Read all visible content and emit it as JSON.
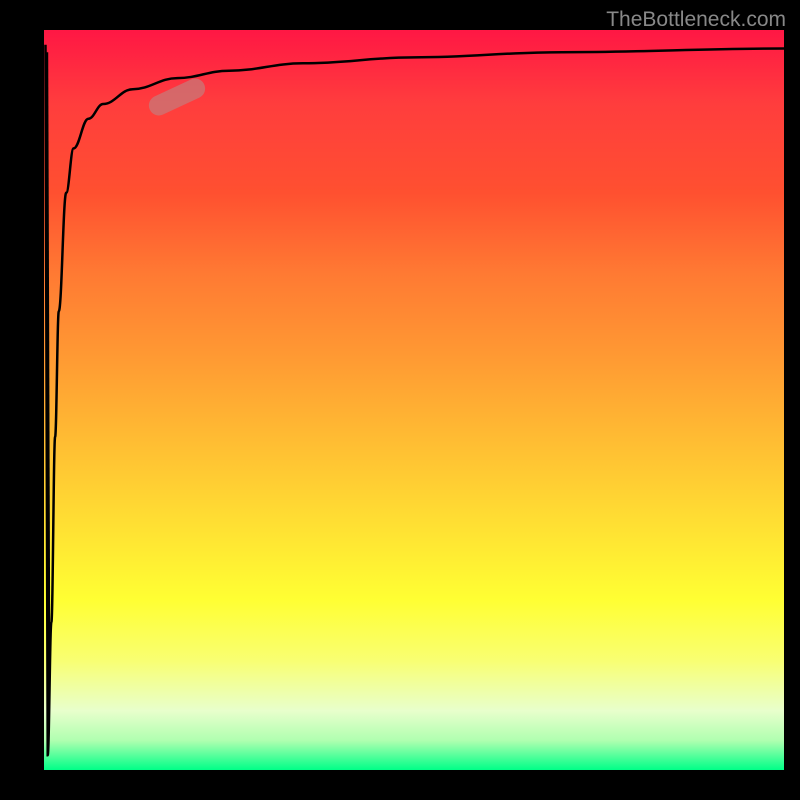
{
  "watermark": "TheBottleneck.com",
  "chart_data": {
    "type": "line",
    "title": "",
    "xlabel": "",
    "ylabel": "",
    "xlim": [
      0,
      100
    ],
    "ylim": [
      0,
      100
    ],
    "x": [
      0.5,
      1,
      1.5,
      2,
      3,
      4,
      6,
      8,
      12,
      18,
      25,
      35,
      50,
      70,
      100
    ],
    "values": [
      2,
      20,
      45,
      62,
      78,
      84,
      88,
      90,
      92,
      93.5,
      94.5,
      95.5,
      96.3,
      97,
      97.5
    ],
    "marker_position": {
      "x": 18,
      "y": 91
    },
    "background_gradient": [
      "#ff1744",
      "#ff9933",
      "#ffff33",
      "#00ff88"
    ]
  }
}
